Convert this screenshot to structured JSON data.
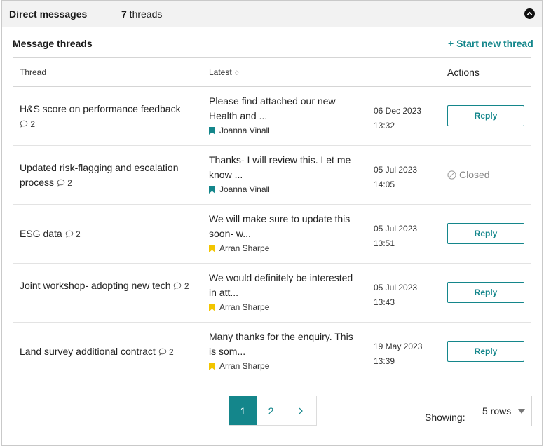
{
  "header": {
    "title": "Direct messages",
    "thread_count": "7",
    "thread_count_suffix": " threads"
  },
  "section": {
    "title": "Message threads",
    "start_thread_label": "+ Start new thread"
  },
  "table": {
    "columns": {
      "thread": "Thread",
      "latest": "Latest",
      "sort_icon": "♢",
      "actions": "Actions"
    },
    "rows": [
      {
        "title": "H&S score on performance feedback",
        "comments": "2",
        "latest": "Please find attached our new Health and ...",
        "author": "Joanna Vinall",
        "flag_color": "#14868b",
        "date": "06 Dec 2023",
        "time": "13:32",
        "action": "Reply",
        "status": "open"
      },
      {
        "title": "Updated risk-flagging and escalation process",
        "comments": "2",
        "latest": "Thanks- I will review this. Let me know ...",
        "author": "Joanna Vinall",
        "flag_color": "#14868b",
        "date": "05 Jul 2023",
        "time": "14:05",
        "action": "Closed",
        "status": "closed"
      },
      {
        "title": "ESG data",
        "comments": "2",
        "latest": "We will make sure to update this soon- w...",
        "author": "Arran Sharpe",
        "flag_color": "#f2c500",
        "date": "05 Jul 2023",
        "time": "13:51",
        "action": "Reply",
        "status": "open"
      },
      {
        "title": "Joint workshop- adopting new tech",
        "comments": "2",
        "latest": "We would definitely be interested in att...",
        "author": "Arran Sharpe",
        "flag_color": "#f2c500",
        "date": "05 Jul 2023",
        "time": "13:43",
        "action": "Reply",
        "status": "open"
      },
      {
        "title": "Land survey additional contract",
        "comments": "2",
        "latest": "Many thanks for the enquiry. This is som...",
        "author": "Arran Sharpe",
        "flag_color": "#f2c500",
        "date": "19 May 2023",
        "time": "13:39",
        "action": "Reply",
        "status": "open"
      }
    ]
  },
  "pagination": {
    "pages": [
      "1",
      "2"
    ],
    "current": "1",
    "next_icon": "chevron-right-icon"
  },
  "footer": {
    "showing_label": "Showing:",
    "rows_value": "5 rows"
  },
  "colors": {
    "accent": "#14868b",
    "flag_teal": "#14868b",
    "flag_yellow": "#f2c500",
    "closed_gray": "#888888"
  }
}
